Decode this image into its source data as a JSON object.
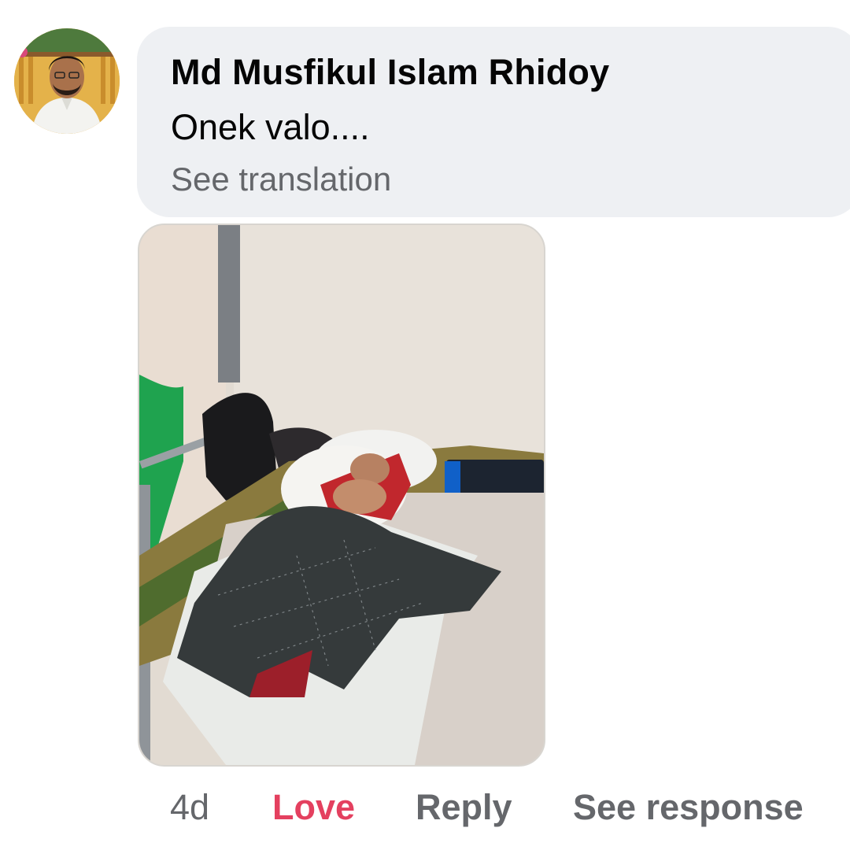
{
  "comment": {
    "author": "Md Musfikul Islam Rhidoy",
    "text": "Onek valo....",
    "see_translation": "See translation",
    "timestamp": "4d"
  },
  "actions": {
    "reaction": "Love",
    "reply": "Reply",
    "see_response": "See response"
  },
  "colors": {
    "bubble_background": "#eef0f3",
    "secondary_text": "#65676b",
    "love_reaction": "#e4405f",
    "primary_text": "#050505"
  }
}
